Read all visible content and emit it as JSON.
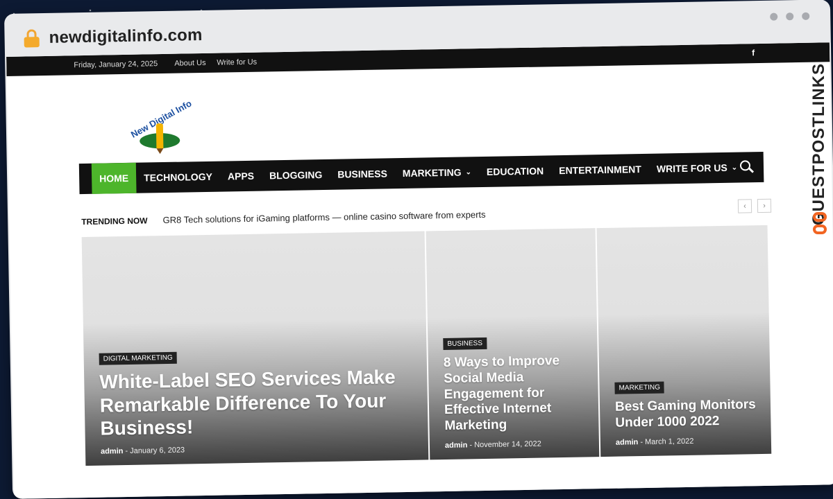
{
  "browser": {
    "url": "newdigitalinfo.com"
  },
  "topbar": {
    "date": "Friday, January 24, 2025",
    "links": [
      "About Us",
      "Write for Us"
    ],
    "social_icon": "facebook-icon"
  },
  "logo": {
    "text": "New Digital Info"
  },
  "nav": {
    "items": [
      {
        "label": "HOME",
        "active": true
      },
      {
        "label": "TECHNOLOGY"
      },
      {
        "label": "APPS"
      },
      {
        "label": "BLOGGING"
      },
      {
        "label": "BUSINESS"
      },
      {
        "label": "MARKETING",
        "dropdown": true
      },
      {
        "label": "EDUCATION"
      },
      {
        "label": "ENTERTAINMENT"
      },
      {
        "label": "WRITE FOR US",
        "dropdown": true
      }
    ],
    "accent": "#4db52b"
  },
  "trending": {
    "label": "TRENDING NOW",
    "headline": "GR8 Tech solutions for iGaming platforms — online casino software from experts",
    "prev": "‹",
    "next": "›"
  },
  "featured": [
    {
      "category": "DIGITAL MARKETING",
      "title": "White-Label SEO Services Make Remarkable Difference To Your Business!",
      "author": "admin",
      "date": "January 6, 2023"
    },
    {
      "category": "BUSINESS",
      "title": "8 Ways to Improve Social Media Engagement for Effective Internet Marketing",
      "author": "admin",
      "date": "November 14, 2022"
    },
    {
      "category": "MARKETING",
      "title": "Best Gaming Monitors Under 1000 2022",
      "author": "admin",
      "date": "March 1, 2022"
    }
  ],
  "watermark": {
    "text": "GUESTPOSTLINKS",
    "accent": "#f26522"
  }
}
